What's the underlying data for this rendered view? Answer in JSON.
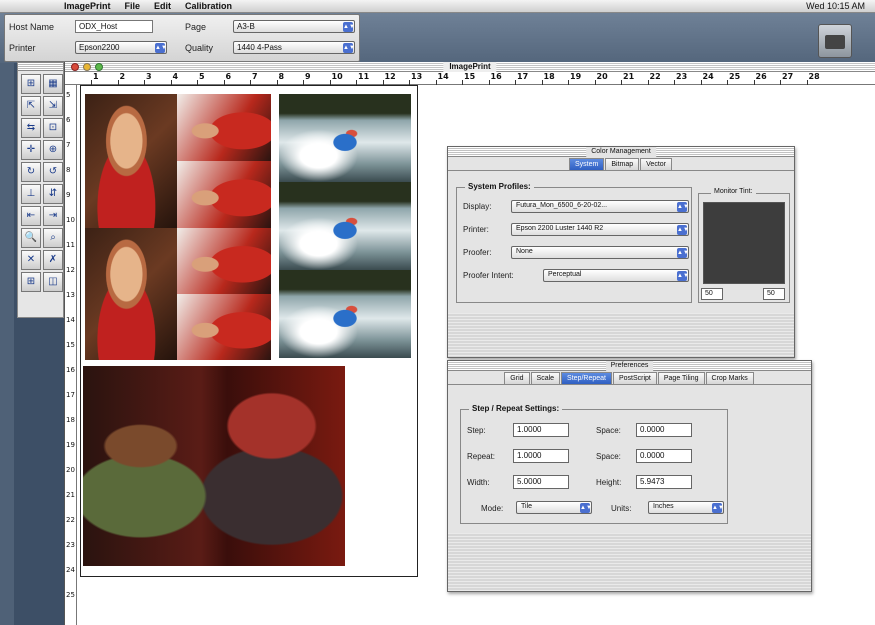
{
  "menubar": {
    "items": [
      "ImagePrint",
      "File",
      "Edit",
      "Calibration"
    ],
    "clock": "Wed 10:15 AM"
  },
  "host_panel": {
    "host_label": "Host Name",
    "host_value": "ODX_Host",
    "printer_label": "Printer",
    "printer_value": "Epson2200",
    "page_label": "Page",
    "page_value": "A3-B",
    "quality_label": "Quality",
    "quality_value": "1440 4-Pass"
  },
  "toolbox": {
    "tools": [
      "zoom-in-icon",
      "pointer-icon",
      "rotate-left-icon",
      "rotate-right-icon",
      "flip-icon",
      "crop-icon",
      "center-icon",
      "align-icon",
      "magnify-icon",
      "zoom-out-icon",
      "delete-icon",
      "cut-icon",
      "grid-icon",
      "layout-icon",
      "move-icon",
      "x1-icon"
    ],
    "glyphs": [
      "⊞",
      "▦",
      "⇱",
      "⇲",
      "⇆",
      "⊡",
      "✛",
      "⊕",
      "↻",
      "↺",
      "⊥",
      "⇵",
      "⇤",
      "⇥",
      "🔍",
      "⌕",
      "✕",
      "✗",
      "⊞",
      "◫",
      "✥",
      "×1"
    ]
  },
  "image_window": {
    "title": "ImagePrint",
    "ruler_h": [
      "1",
      "2",
      "3",
      "4",
      "5",
      "6",
      "7",
      "8",
      "9",
      "10",
      "11",
      "12",
      "13",
      "14",
      "15",
      "16",
      "17",
      "18",
      "19",
      "20",
      "21",
      "22",
      "23",
      "24",
      "25",
      "26",
      "27",
      "28"
    ],
    "ruler_v": [
      "5",
      "6",
      "7",
      "8",
      "9",
      "10",
      "11",
      "12",
      "13",
      "14",
      "15",
      "16",
      "17",
      "18",
      "19",
      "20",
      "21",
      "22",
      "23",
      "24",
      "25"
    ]
  },
  "color_management": {
    "title": "Color Management",
    "tabs": [
      "System",
      "Bitmap",
      "Vector"
    ],
    "active_tab": "System",
    "group_label": "System Profiles:",
    "display_label": "Display:",
    "display_value": "Futura_Mon_6500_6-20-02...",
    "printer_label": "Printer:",
    "printer_value": "Epson 2200 Luster 1440 R2",
    "proofer_label": "Proofer:",
    "proofer_value": "None",
    "intent_label": "Proofer Intent:",
    "intent_value": "Perceptual",
    "monitor_label": "Monitor Tint:",
    "tint_left": "50",
    "tint_right": "50"
  },
  "preferences": {
    "title": "Preferences",
    "tabs": [
      "Grid",
      "Scale",
      "Step/Repeat",
      "PostScript",
      "Page Tiling",
      "Crop Marks"
    ],
    "active_tab": "Step/Repeat",
    "group_label": "Step / Repeat Settings:",
    "step_label": "Step:",
    "step_value": "1.0000",
    "space1_label": "Space:",
    "space1_value": "0.0000",
    "repeat_label": "Repeat:",
    "repeat_value": "1.0000",
    "space2_label": "Space:",
    "space2_value": "0.0000",
    "width_label": "Width:",
    "width_value": "5.0000",
    "height_label": "Height:",
    "height_value": "5.9473",
    "mode_label": "Mode:",
    "mode_value": "Tile",
    "units_label": "Units:",
    "units_value": "Inches"
  }
}
